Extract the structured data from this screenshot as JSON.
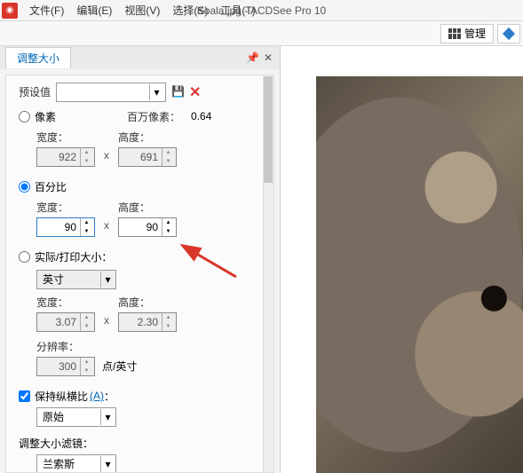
{
  "app": {
    "title": "Koala.jpg - ACDSee Pro 10"
  },
  "menu": {
    "file": "文件(F)",
    "edit": "编辑(E)",
    "view": "视图(V)",
    "select": "选择(S)",
    "tools": "工具(T)"
  },
  "toolbar": {
    "manage": "管理"
  },
  "panel": {
    "tab": "调整大小",
    "preset_label": "预设值",
    "pixel": {
      "radio": "像素",
      "mpx_label": "百万像素：",
      "mpx_value": "0.64",
      "width_label": "宽度：",
      "width_value": "922",
      "height_label": "高度：",
      "height_value": "691"
    },
    "percent": {
      "radio": "百分比",
      "width_label": "宽度：",
      "width_value": "90",
      "height_label": "高度：",
      "height_value": "90"
    },
    "print": {
      "radio": "实际/打印大小：",
      "unit": "英寸",
      "width_label": "宽度：",
      "width_value": "3.07",
      "height_label": "高度：",
      "height_value": "2.30",
      "res_label": "分辨率：",
      "res_value": "300",
      "dpi": "点/英寸"
    },
    "aspect": {
      "label": "保持纵横比",
      "link": "(A)",
      "select": "原始"
    },
    "filter": {
      "label": "调整大小滤镜：",
      "value": "兰索斯"
    }
  }
}
